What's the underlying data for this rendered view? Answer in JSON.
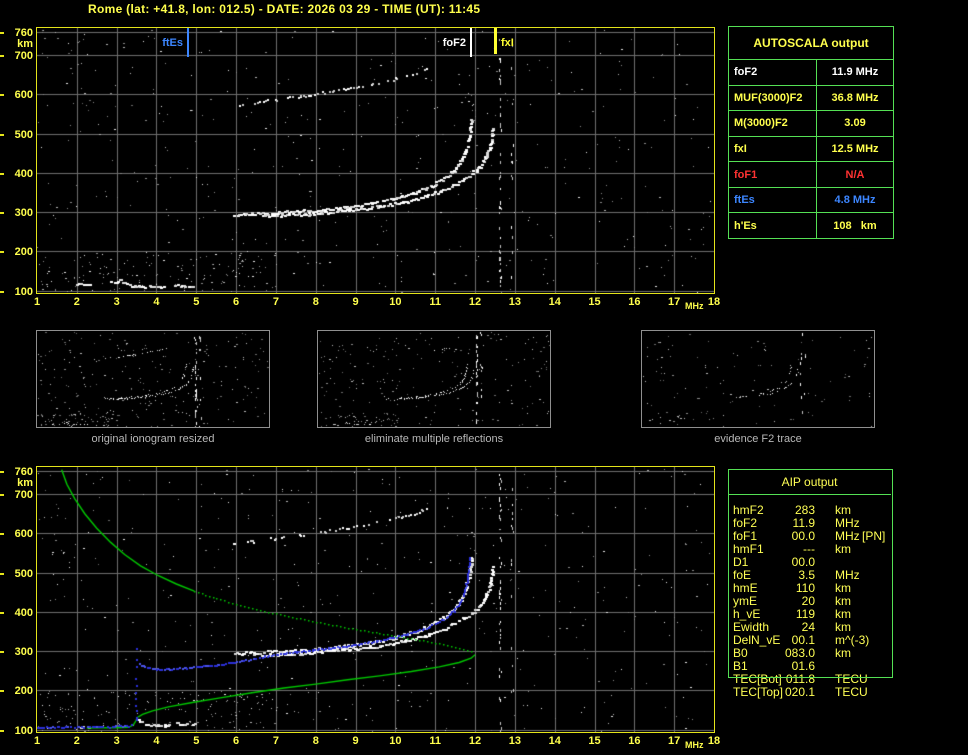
{
  "title": "Rome (lat: +41.8, lon: 012.5) - DATE: 2026 03 29 - TIME (UT): 11:45",
  "colors": {
    "yellow_text": "#ffff4d",
    "border_yellow": "#e4e41a",
    "table_green": "#54e054",
    "profile_green": "#00c800",
    "marker_blue": "#3c86ff",
    "trace_blue": "#2a2fd8",
    "red": "#ff3232",
    "white": "#ffffff",
    "grid_gray": "#6f6f6f",
    "caption_gray": "#b8b8b8",
    "noise_gray": "#909090"
  },
  "axes": {
    "y_unit": "km",
    "x_unit": "MHz",
    "y_ticks": [
      760,
      700,
      600,
      500,
      400,
      300,
      200,
      100
    ],
    "x_ticks": [
      1,
      2,
      3,
      4,
      5,
      6,
      7,
      8,
      9,
      10,
      11,
      12,
      13,
      14,
      15,
      16,
      17,
      18
    ]
  },
  "thumbnails": [
    {
      "caption": "original ionogram resized"
    },
    {
      "caption": "eliminate multiple reflections"
    },
    {
      "caption": "evidence F2 trace"
    }
  ],
  "autoscala_table": {
    "title": "AUTOSCALA output",
    "rows": [
      {
        "label": "foF2",
        "value": "11.9 MHz",
        "color": "white"
      },
      {
        "label": "MUF(3000)F2",
        "value": "36.8 MHz",
        "color": "yellow"
      },
      {
        "label": "M(3000)F2",
        "value": "3.09",
        "color": "yellow"
      },
      {
        "label": "fxI",
        "value": "12.5 MHz",
        "color": "yellow"
      },
      {
        "label": "foF1",
        "value": "N/A",
        "color": "red"
      },
      {
        "label": "ftEs",
        "value": "4.8 MHz",
        "color": "blue"
      },
      {
        "label": "h'Es",
        "value": "108   km",
        "color": "yellow"
      }
    ]
  },
  "aip_table": {
    "title": "AIP output",
    "rows": [
      {
        "label": "hmF2",
        "value": "283",
        "unit": "km",
        "suffix": ""
      },
      {
        "label": "foF2",
        "value": "11.9",
        "unit": "MHz",
        "suffix": ""
      },
      {
        "label": "foF1",
        "value": "00.0",
        "unit": "MHz",
        "suffix": "[PN]"
      },
      {
        "label": "hmF1",
        "value": "---",
        "unit": "km",
        "suffix": ""
      },
      {
        "label": "D1",
        "value": "00.0",
        "unit": "",
        "suffix": ""
      },
      {
        "label": "foE",
        "value": "3.5",
        "unit": "MHz",
        "suffix": ""
      },
      {
        "label": "hmE",
        "value": "110",
        "unit": "km",
        "suffix": ""
      },
      {
        "label": "ymE",
        "value": "20",
        "unit": "km",
        "suffix": ""
      },
      {
        "label": "h_vE",
        "value": "119",
        "unit": "km",
        "suffix": ""
      },
      {
        "label": "Ewidth",
        "value": "24",
        "unit": "km",
        "suffix": ""
      },
      {
        "label": "DelN_vE",
        "value": "00.1",
        "unit": "m^(-3)",
        "suffix": ""
      },
      {
        "label": "B0",
        "value": "083.0",
        "unit": "km",
        "suffix": ""
      },
      {
        "label": "B1",
        "value": "01.6",
        "unit": "",
        "suffix": ""
      },
      {
        "label": "TEC[Bot]",
        "value": "011.8",
        "unit": "TECU",
        "suffix": ""
      },
      {
        "label": "TEC[Top]",
        "value": "020.1",
        "unit": "TECU",
        "suffix": ""
      }
    ]
  },
  "chart_data": [
    {
      "type": "scatter",
      "title": "ionogram with AUTOSCALA characteristic markers",
      "xlabel": "MHz",
      "ylabel": "km",
      "xlim": [
        1,
        18
      ],
      "ylim": [
        100,
        760
      ],
      "grid": true,
      "legend_position": "none",
      "markers": [
        {
          "label": "ftEs",
          "freq": 4.8,
          "color": "#3c86ff",
          "label_side": "left"
        },
        {
          "label": "foF2",
          "freq": 11.9,
          "color": "#ffffff",
          "label_side": "left"
        },
        {
          "label": "fxI",
          "freq": 12.5,
          "color": "#ffff33",
          "label_side": "right"
        }
      ],
      "series": [
        {
          "name": "F2 ordinary echo trace",
          "points": [
            [
              5.95,
              296
            ],
            [
              6.4,
              297
            ],
            [
              7.0,
              300
            ],
            [
              7.6,
              303
            ],
            [
              8.2,
              308
            ],
            [
              8.8,
              315
            ],
            [
              9.4,
              324
            ],
            [
              10.0,
              337
            ],
            [
              10.5,
              352
            ],
            [
              10.9,
              369
            ],
            [
              11.2,
              387
            ],
            [
              11.45,
              408
            ],
            [
              11.62,
              432
            ],
            [
              11.74,
              458
            ],
            [
              11.82,
              488
            ],
            [
              11.87,
              515
            ],
            [
              11.9,
              540
            ]
          ]
        },
        {
          "name": "F2 extraordinary echo trace",
          "points": [
            [
              6.6,
              290
            ],
            [
              7.2,
              293
            ],
            [
              7.8,
              297
            ],
            [
              8.4,
              302
            ],
            [
              9.0,
              308
            ],
            [
              9.6,
              316
            ],
            [
              10.2,
              327
            ],
            [
              10.7,
              340
            ],
            [
              11.1,
              354
            ],
            [
              11.5,
              372
            ],
            [
              11.85,
              394
            ],
            [
              12.1,
              416
            ],
            [
              12.25,
              440
            ],
            [
              12.35,
              468
            ],
            [
              12.4,
              497
            ],
            [
              12.42,
              515
            ]
          ]
        },
        {
          "name": "second-hop F2 reflection trace",
          "points": [
            [
              5.9,
              574
            ],
            [
              6.4,
              581
            ],
            [
              7.0,
              589
            ],
            [
              7.6,
              597
            ],
            [
              8.2,
              606
            ],
            [
              8.8,
              616
            ],
            [
              9.4,
              628
            ],
            [
              10.0,
              641
            ],
            [
              10.45,
              652
            ],
            [
              10.8,
              664
            ]
          ]
        },
        {
          "name": "sporadic-E echo segments",
          "segments": [
            [
              2.0,
              118,
              2.3,
              116
            ],
            [
              2.85,
              122,
              3.1,
              127
            ],
            [
              3.1,
              126,
              3.35,
              118
            ],
            [
              3.35,
              113,
              4.15,
              112
            ],
            [
              4.4,
              114,
              4.95,
              113
            ]
          ]
        },
        {
          "name": "interference columns",
          "freqs": [
            12.62,
            12.92
          ]
        }
      ]
    },
    {
      "type": "line",
      "title": "ionogram with restored trace and electron density profile",
      "xlabel": "MHz",
      "ylabel": "km",
      "xlim": [
        1,
        18
      ],
      "ylim": [
        100,
        760
      ],
      "grid": true,
      "series": [
        {
          "name": "restored trace (blue)",
          "color": "#2a2fd8",
          "flat": [
            [
              1.0,
              107
            ],
            [
              3.3,
              110
            ]
          ],
          "rise": [
            [
              3.3,
              111
            ],
            [
              3.5,
              126
            ]
          ],
          "vertical": {
            "freq": 3.47,
            "km_range": [
              135,
              320
            ]
          },
          "points": [
            [
              3.55,
              268
            ],
            [
              3.75,
              260
            ],
            [
              4.0,
              256
            ],
            [
              4.3,
              256
            ],
            [
              4.7,
              259
            ],
            [
              5.1,
              263
            ],
            [
              5.5,
              267
            ],
            [
              5.9,
              272
            ],
            [
              6.3,
              279
            ],
            [
              6.7,
              288
            ],
            [
              7.1,
              295
            ],
            [
              7.5,
              299
            ],
            [
              7.9,
              304
            ],
            [
              8.3,
              309
            ],
            [
              8.7,
              314
            ],
            [
              9.1,
              320
            ],
            [
              9.5,
              327
            ],
            [
              9.9,
              335
            ],
            [
              10.3,
              345
            ],
            [
              10.7,
              358
            ],
            [
              11.0,
              371
            ],
            [
              11.25,
              386
            ],
            [
              11.45,
              404
            ],
            [
              11.6,
              424
            ],
            [
              11.7,
              448
            ],
            [
              11.78,
              478
            ],
            [
              11.83,
              510
            ],
            [
              11.86,
              540
            ]
          ]
        },
        {
          "name": "N(h) profile topside solid (green)",
          "color": "#00c800",
          "points": [
            [
              1.62,
              762
            ],
            [
              1.75,
              725
            ],
            [
              1.95,
              688
            ],
            [
              2.2,
              650
            ],
            [
              2.5,
              613
            ],
            [
              2.85,
              577
            ],
            [
              3.2,
              546
            ],
            [
              3.6,
              517
            ],
            [
              4.05,
              492
            ],
            [
              4.5,
              471
            ],
            [
              4.95,
              453
            ]
          ]
        },
        {
          "name": "N(h) profile topside dotted (green)",
          "color": "#00c800",
          "points": [
            [
              4.95,
              453
            ],
            [
              5.6,
              432
            ],
            [
              6.3,
              412
            ],
            [
              7.0,
              396
            ],
            [
              7.7,
              381
            ],
            [
              8.4,
              367
            ],
            [
              9.1,
              355
            ],
            [
              9.8,
              343
            ],
            [
              10.5,
              331
            ],
            [
              11.1,
              320
            ],
            [
              11.6,
              309
            ],
            [
              11.9,
              300
            ],
            [
              12.0,
              293
            ]
          ]
        },
        {
          "name": "N(h) profile bottomside solid (green)",
          "color": "#00c800",
          "points": [
            [
              12.0,
              291
            ],
            [
              11.9,
              282
            ],
            [
              11.6,
              271
            ],
            [
              11.1,
              260
            ],
            [
              10.4,
              248
            ],
            [
              9.6,
              237
            ],
            [
              8.8,
              227
            ],
            [
              8.0,
              216
            ],
            [
              7.2,
              206
            ],
            [
              6.4,
              194
            ],
            [
              5.6,
              181
            ],
            [
              4.9,
              169
            ],
            [
              4.3,
              158
            ],
            [
              3.9,
              148
            ],
            [
              3.65,
              139
            ],
            [
              3.52,
              131
            ]
          ]
        },
        {
          "name": "N(h) profile E-region (green)",
          "color": "#00c800",
          "points": [
            [
              3.52,
              131
            ],
            [
              3.48,
              122
            ],
            [
              3.42,
              112
            ],
            [
              3.3,
              106
            ],
            [
              3.0,
              105
            ],
            [
              2.6,
              105
            ],
            [
              2.25,
              104
            ]
          ]
        },
        {
          "name": "sporadic-E echo segments",
          "segments": [
            [
              3.5,
              127,
              3.78,
              114
            ],
            [
              3.78,
              113,
              4.3,
              112
            ],
            [
              4.5,
              117,
              4.98,
              115
            ],
            [
              2.02,
              109,
              2.3,
              108
            ]
          ]
        }
      ]
    }
  ]
}
